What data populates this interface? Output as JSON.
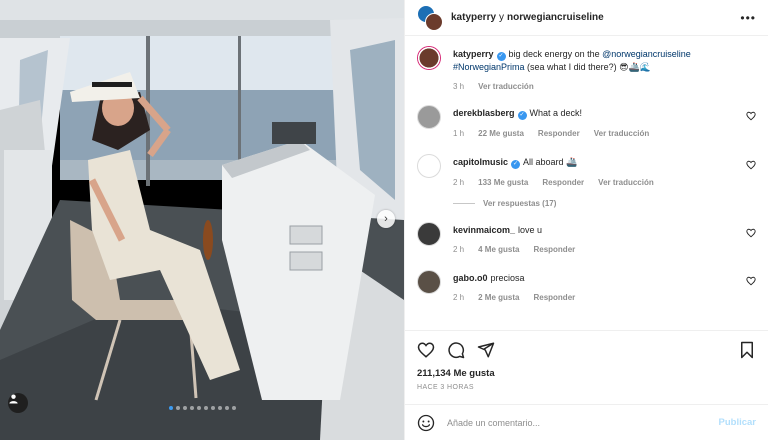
{
  "header": {
    "author": "katyperry",
    "conjunction": "y",
    "coauthor": "norwegiancruiseline",
    "more_icon": "more-horizontal-icon"
  },
  "caption": {
    "username": "katyperry",
    "text": "big deck energy on the",
    "mention": "@norwegiancruiseline",
    "hashtag": "#NorwegianPrima",
    "rest": "(sea what I did there?) 😎🚢🌊",
    "time": "3 h",
    "translate": "Ver traducción"
  },
  "comments": [
    {
      "username": "derekblasberg",
      "verified": true,
      "text": "What a deck!",
      "time": "1 h",
      "likes": "22 Me gusta",
      "reply": "Responder",
      "translate": "Ver traducción",
      "avatar_color": "#9a9a9a"
    },
    {
      "username": "capitolmusic",
      "verified": true,
      "text": "All aboard 🚢",
      "time": "2 h",
      "likes": "133 Me gusta",
      "reply": "Responder",
      "translate": "Ver traducción",
      "avatar_color": "#ffffff"
    },
    {
      "username": "kevinmaicom_",
      "verified": false,
      "text": "love u",
      "time": "2 h",
      "likes": "4 Me gusta",
      "reply": "Responder",
      "translate": "",
      "avatar_color": "#3a3a3a"
    },
    {
      "username": "gabo.o0",
      "verified": false,
      "text": "preciosa",
      "time": "2 h",
      "likes": "2 Me gusta",
      "reply": "Responder",
      "translate": "",
      "avatar_color": "#5a5046"
    }
  ],
  "replies_label": "Ver respuestas (17)",
  "post": {
    "likes": "211,134 Me gusta",
    "time_ago": "HACE 3 HORAS"
  },
  "composer": {
    "placeholder": "Añade un comentario...",
    "publish": "Publicar"
  },
  "carousel": {
    "slide_count": 10,
    "active_index": 0,
    "accent": "#3d9bf0"
  },
  "colors": {
    "link": "#00376b",
    "muted": "#8e8e8e",
    "verified": "#3897f0",
    "publish": "#b2dffc"
  }
}
